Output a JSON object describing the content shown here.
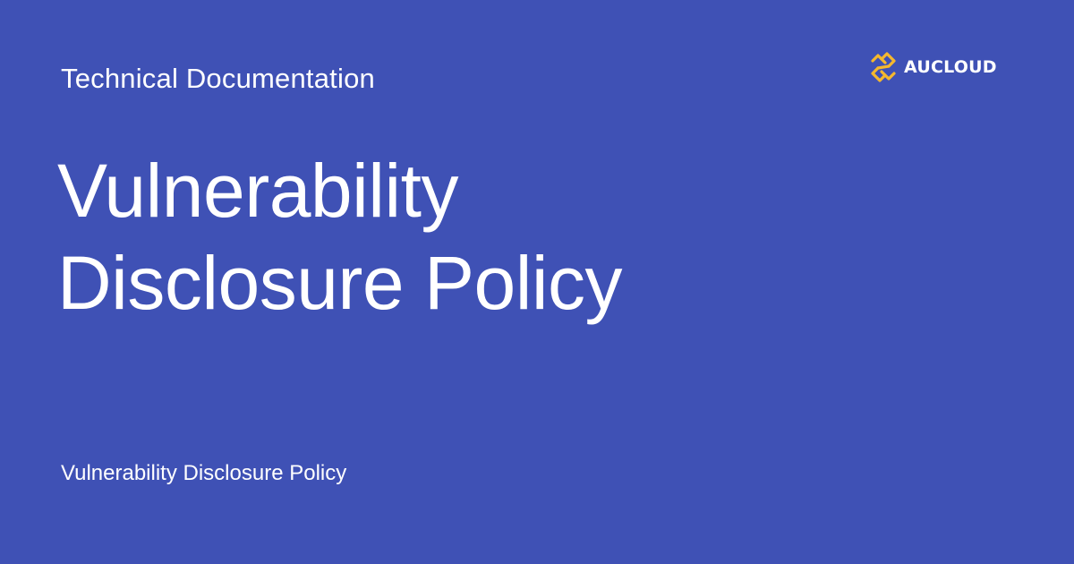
{
  "header": {
    "eyebrow": "Technical Documentation"
  },
  "brand": {
    "name": "AUCLOUD",
    "icon": "aucloud-logo-icon",
    "accent_color": "#f5b82e",
    "background_color": "#3f51b5"
  },
  "main": {
    "title_line_1": "Vulnerability",
    "title_line_2": "Disclosure Policy"
  },
  "footer": {
    "text": "Vulnerability Disclosure Policy"
  }
}
